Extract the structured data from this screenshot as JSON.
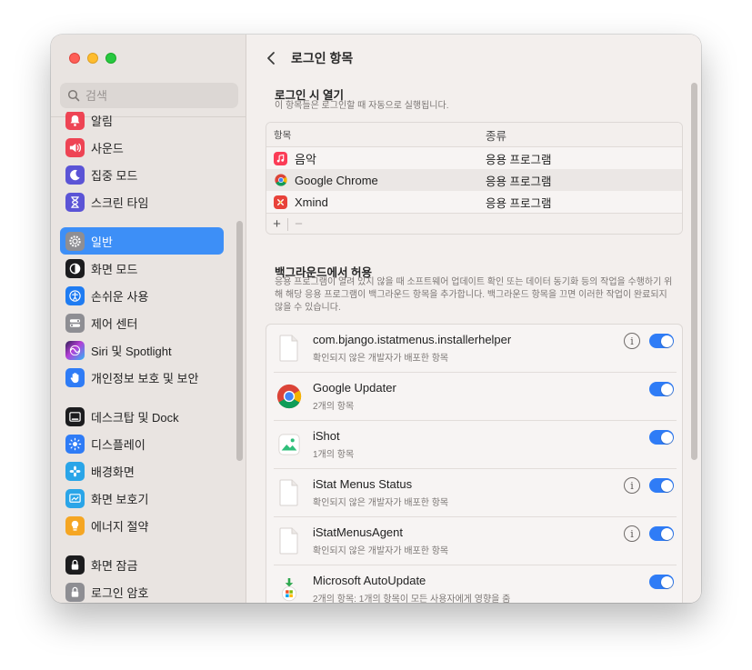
{
  "sidebar": {
    "search_placeholder": "검색",
    "items": [
      {
        "label": "알림",
        "icon": "bell-icon",
        "color": "#ee4454"
      },
      {
        "label": "사운드",
        "icon": "speaker-icon",
        "color": "#ee4454"
      },
      {
        "label": "집중 모드",
        "icon": "moon-icon",
        "color": "#5b54d6"
      },
      {
        "label": "스크린 타임",
        "icon": "hourglass-icon",
        "color": "#5b54d6"
      },
      {
        "label": "일반",
        "icon": "gear-icon",
        "color": "#8e8e93"
      },
      {
        "label": "화면 모드",
        "icon": "appearance-icon",
        "color": "#1c1c1e"
      },
      {
        "label": "손쉬운 사용",
        "icon": "accessibility-icon",
        "color": "#1f7cf2"
      },
      {
        "label": "제어 센터",
        "icon": "control-center-icon",
        "color": "#8e8e93"
      },
      {
        "label": "Siri 및 Spotlight",
        "icon": "siri-icon",
        "color": "#9b3fd6"
      },
      {
        "label": "개인정보 보호 및 보안",
        "icon": "hand-icon",
        "color": "#2f7cf6"
      },
      {
        "label": "데스크탑 및 Dock",
        "icon": "dock-icon",
        "color": "#1c1c1e"
      },
      {
        "label": "디스플레이",
        "icon": "display-icon",
        "color": "#2f7cf6"
      },
      {
        "label": "배경화면",
        "icon": "wallpaper-icon",
        "color": "#2aa5e8"
      },
      {
        "label": "화면 보호기",
        "icon": "screensaver-icon",
        "color": "#2aa5e8"
      },
      {
        "label": "에너지 절약",
        "icon": "battery-icon",
        "color": "#f5a623"
      },
      {
        "label": "화면 잠금",
        "icon": "lock-icon",
        "color": "#1c1c1e"
      },
      {
        "label": "로그인 암호",
        "icon": "lock-icon",
        "color": "#8e8e93"
      }
    ]
  },
  "main": {
    "title": "로그인 항목",
    "open_at_login": {
      "title": "로그인 시 열기",
      "subtitle": "이 항목들은 로그인할 때 자동으로 실행됩니다.",
      "columns": [
        "항목",
        "종류"
      ],
      "rows": [
        {
          "name": "음악",
          "kind": "응용 프로그램",
          "icon": "music-icon"
        },
        {
          "name": "Google Chrome",
          "kind": "응용 프로그램",
          "icon": "chrome-icon"
        },
        {
          "name": "Xmind",
          "kind": "응용 프로그램",
          "icon": "xmind-icon"
        }
      ],
      "add_label": "+",
      "remove_label": "−"
    },
    "background": {
      "title": "백그라운드에서 허용",
      "description": "응용 프로그램이 열려 있지 않을 때 소프트웨어 업데이트 확인 또는 데이터 동기화 등의 작업을 수행하기 위해 해당 응용 프로그램이 백그라운드 항목을 추가합니다. 백그라운드 항목을 끄면 이러한 작업이 완료되지 않을 수 있습니다.",
      "items": [
        {
          "name": "com.bjango.istatmenus.installerhelper",
          "sub": "확인되지 않은 개발자가 배포한 항목",
          "icon": "document-icon",
          "info": true,
          "enabled": true
        },
        {
          "name": "Google Updater",
          "sub": "2개의 항목",
          "icon": "chrome-icon",
          "info": false,
          "enabled": true
        },
        {
          "name": "iShot",
          "sub": "1개의 항목",
          "icon": "ishot-icon",
          "info": false,
          "enabled": true
        },
        {
          "name": "iStat Menus Status",
          "sub": "확인되지 않은 개발자가 배포한 항목",
          "icon": "document-icon",
          "info": true,
          "enabled": true
        },
        {
          "name": "iStatMenusAgent",
          "sub": "확인되지 않은 개발자가 배포한 항목",
          "icon": "document-icon",
          "info": true,
          "enabled": true
        },
        {
          "name": "Microsoft AutoUpdate",
          "sub": "2개의 항목: 1개의 항목이 모든 사용자에게 영향을 줌",
          "icon": "microsoft-autoupdate-icon",
          "info": false,
          "enabled": true
        }
      ]
    }
  },
  "colors": {
    "accent": "#3d8ff7",
    "toggle_on": "#2f7cf6"
  }
}
